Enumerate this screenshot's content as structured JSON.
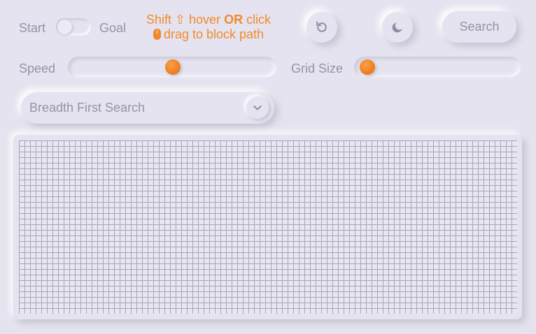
{
  "mode_toggle": {
    "left_label": "Start",
    "right_label": "Goal",
    "state": "start"
  },
  "hint": {
    "line1_pre": "Shift ⇧ hover ",
    "line1_bold": "OR",
    "line1_post": " click",
    "line2": "drag to block path",
    "color": "#f28a2c"
  },
  "toolbar": {
    "reset_icon": "rotate-ccw-icon",
    "theme_icon": "moon-icon",
    "search_label": "Search"
  },
  "speed": {
    "label": "Speed",
    "value_fraction": 0.5
  },
  "grid_size": {
    "label": "Grid Size",
    "value_fraction": 0.0
  },
  "algorithm": {
    "selected": "Breadth First Search",
    "icon": "chevron-down-icon"
  },
  "grid": {
    "columns": 89,
    "rows": 31
  },
  "colors": {
    "accent": "#f28a2c",
    "background": "#e4e3ef",
    "text": "#9594a8",
    "grid_line": "#a6a5b8"
  }
}
